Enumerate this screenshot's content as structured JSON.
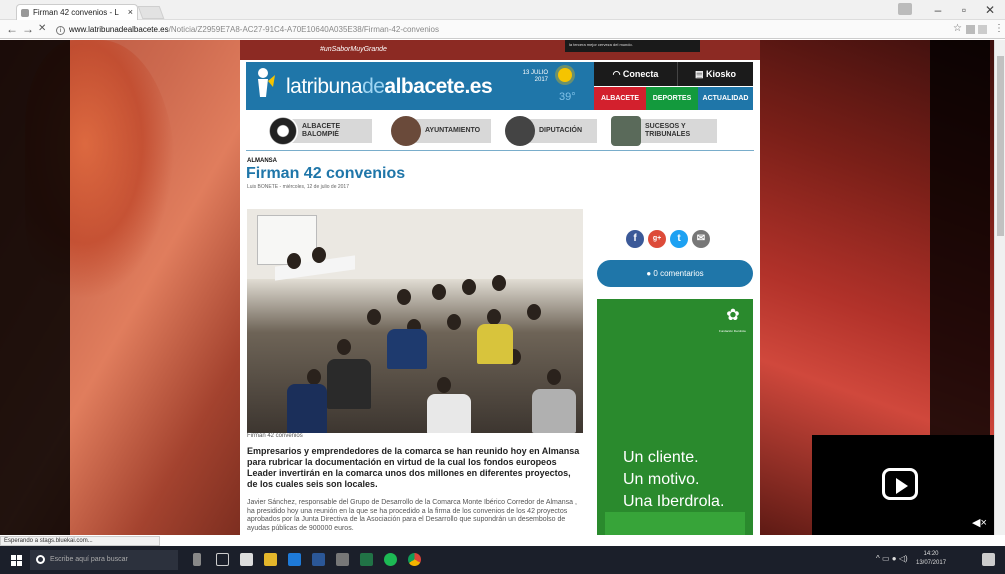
{
  "browser": {
    "tab_title": "Firman 42 convenios - L",
    "tab_close": "×",
    "url_domain": "www.latribunadealbacete.es",
    "url_path": "/Noticia/Z2959E7A8-AC27-91C4-A70E10640A035E38/Firman-42-convenios",
    "nav_back": "←",
    "nav_forward": "→",
    "nav_stop": "✕",
    "win_min": "–",
    "win_max": "▫",
    "win_close": "✕",
    "bookmark": "☆",
    "menu": "⋮",
    "status_text": "Esperando a stags.bluekai.com..."
  },
  "banner": {
    "slogan": "#unSaborMuyGrande",
    "dark_text": "la tercera mejor cerveza del mundo."
  },
  "header": {
    "logo_a": "latribuna",
    "logo_b": "de",
    "logo_c": "albacete.es",
    "date": "13 JULIO 2017",
    "temperature": "39°",
    "conecta": "Conecta",
    "kiosko": "Kiosko",
    "tabs": [
      "ALBACETE",
      "DEPORTES",
      "ACTUALIDAD"
    ],
    "tab_colors": [
      "#d3202d",
      "#139a3d",
      "#1f76a9"
    ]
  },
  "sections": [
    {
      "label_line1": "ALBACETE",
      "label_line2": "BALOMPIÉ"
    },
    {
      "label_line1": "AYUNTAMIENTO",
      "label_line2": ""
    },
    {
      "label_line1": "DIPUTACIÓN",
      "label_line2": ""
    },
    {
      "label_line1": "SUCESOS Y",
      "label_line2": "TRIBUNALES"
    }
  ],
  "article": {
    "kicker": "ALMANSA",
    "headline": "Firman 42 convenios",
    "byline": "Luis BONETE - miércoles, 12 de julio de 2017",
    "caption": "Firman 42 convenios",
    "lead": "Empresarios y emprendedores de la comarca se han reunido hoy en Almansa para rubricar la documentación en virtud de la cual los fondos europeos Leader invertirán en la comarca unos dos millones en diferentes proyectos, de los cuales seis son locales.",
    "body": "Javier Sánchez, responsable del Grupo de Desarrollo de la Comarca Monte Ibérico Corredor de Almansa , ha presidido hoy una reunión en la que se ha procedido a la firma de los convenios de los 42 proyectos aprobados por la Junta Directiva de la Asociación para el Desarrollo que supondrán un desembolso de ayudas públicas de 900000 euros."
  },
  "share": {
    "icons": [
      "f",
      "g+",
      "t",
      "✉"
    ],
    "colors": [
      "#3b5998",
      "#dd4b39",
      "#1da1f2",
      "#777777"
    ],
    "comments": "0 comentarios"
  },
  "ad": {
    "line1": "Un cliente.",
    "line2": "Un motivo.",
    "line3": "Una Iberdrola.",
    "emblem_sub": "Fundación Iberdrola"
  },
  "taskbar": {
    "search_placeholder": "Escribe aquí para buscar",
    "time": "14:20",
    "date": "13/07/2017"
  }
}
